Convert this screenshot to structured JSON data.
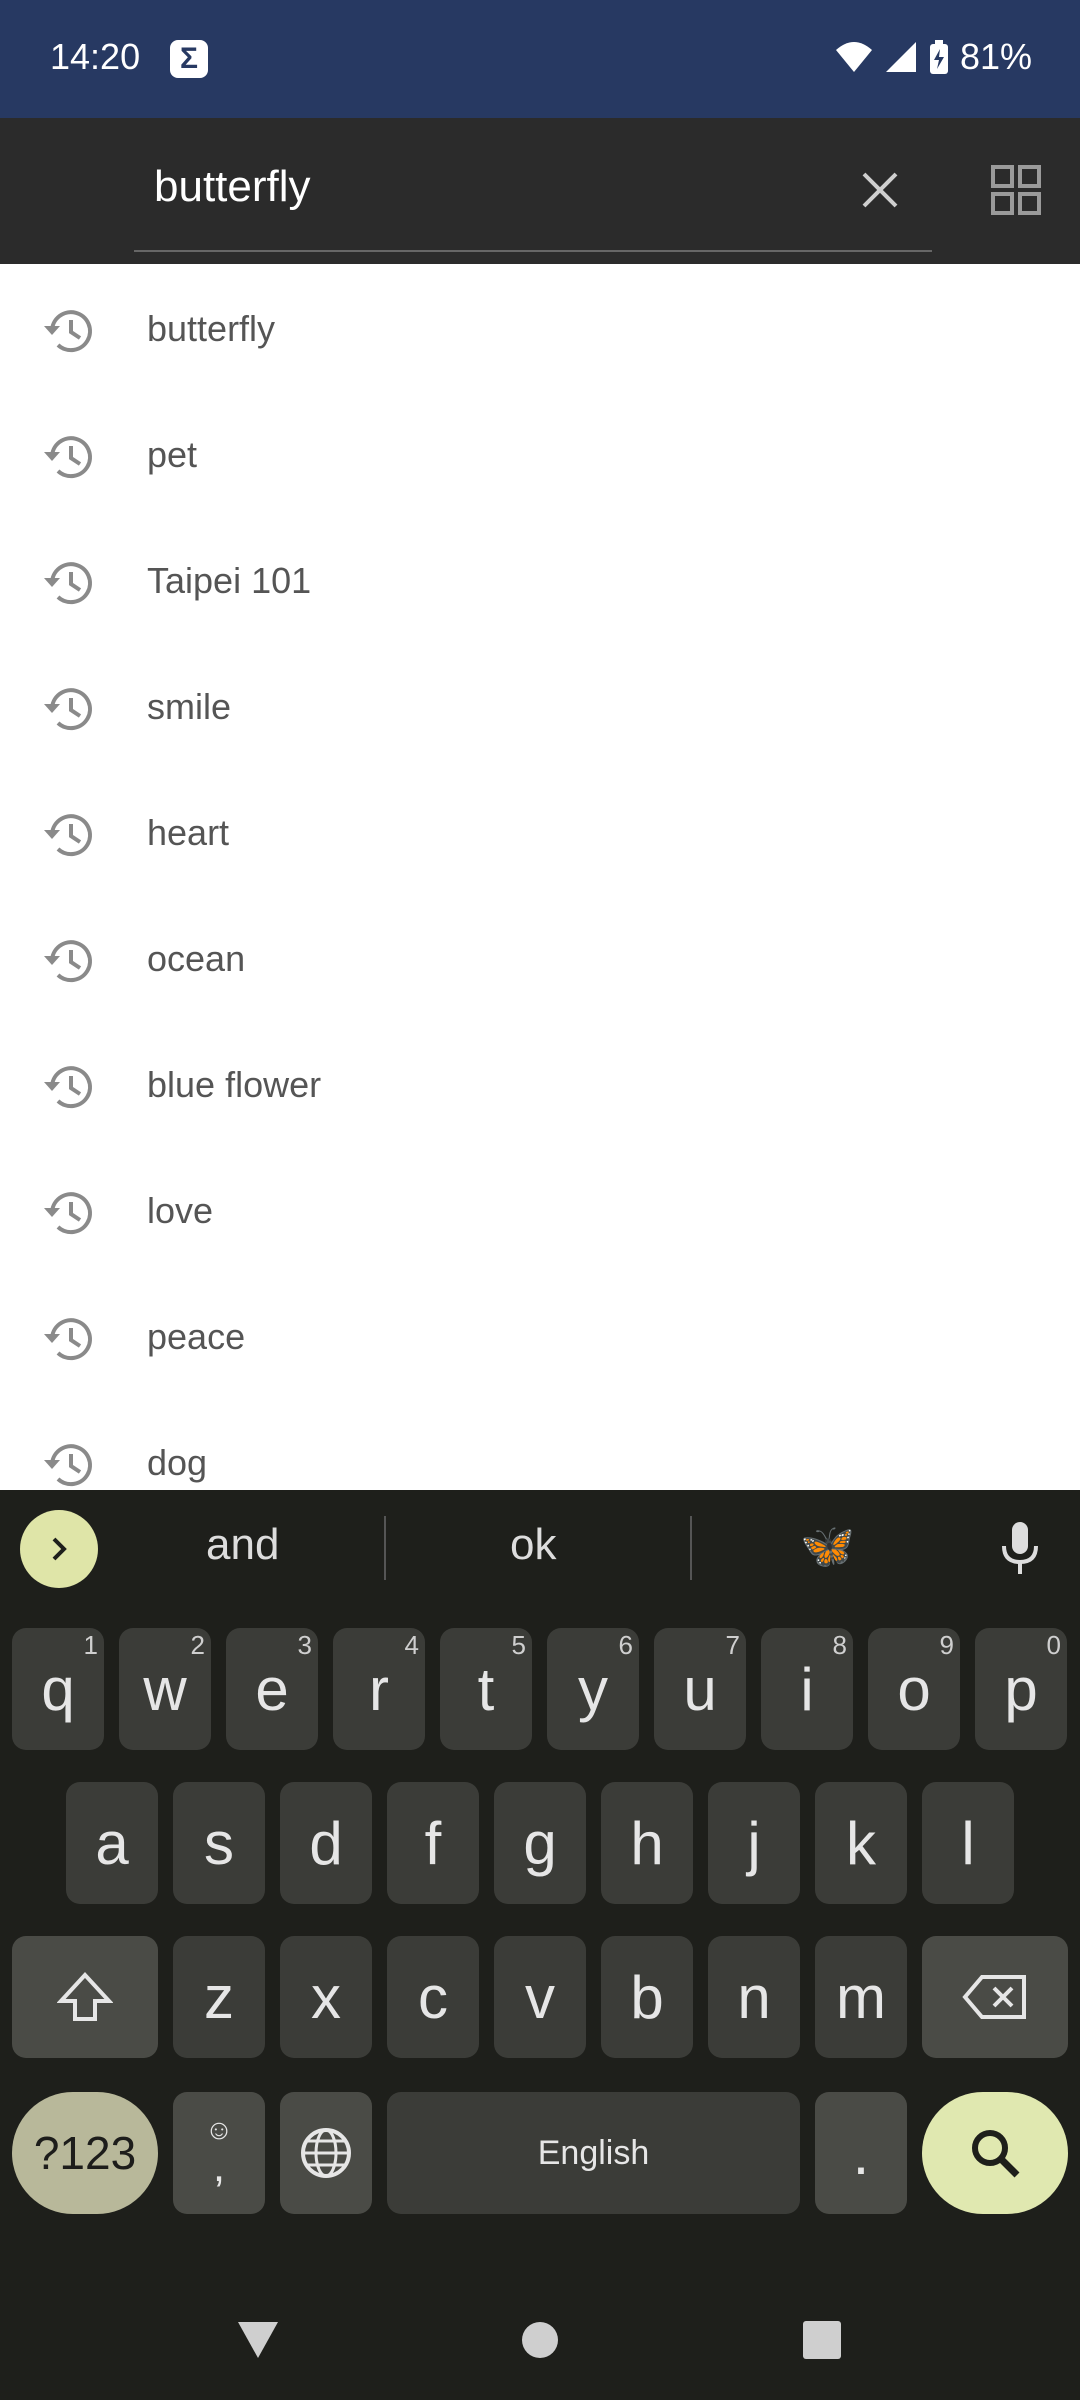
{
  "status_bar": {
    "time": "14:20",
    "app_icon": "sigma-icon",
    "battery_percent": "81%",
    "icons": [
      "wifi-icon",
      "signal-icon",
      "battery-charging-icon"
    ]
  },
  "search": {
    "query": "butterfly",
    "clear_icon": "close-icon",
    "grid_icon": "grid-view-icon"
  },
  "history": [
    "butterfly",
    "pet",
    "Taipei 101",
    "smile",
    "heart",
    "ocean",
    "blue flower",
    "love",
    "peace",
    "dog"
  ],
  "keyboard": {
    "suggestions": [
      "and",
      "ok",
      "🦋"
    ],
    "rows": [
      [
        [
          "q",
          "1"
        ],
        [
          "w",
          "2"
        ],
        [
          "e",
          "3"
        ],
        [
          "r",
          "4"
        ],
        [
          "t",
          "5"
        ],
        [
          "y",
          "6"
        ],
        [
          "u",
          "7"
        ],
        [
          "i",
          "8"
        ],
        [
          "o",
          "9"
        ],
        [
          "p",
          "0"
        ]
      ],
      [
        [
          "a",
          ""
        ],
        [
          "s",
          ""
        ],
        [
          "d",
          ""
        ],
        [
          "f",
          ""
        ],
        [
          "g",
          ""
        ],
        [
          "h",
          ""
        ],
        [
          "j",
          ""
        ],
        [
          "k",
          ""
        ],
        [
          "l",
          ""
        ]
      ],
      [
        [
          "z",
          ""
        ],
        [
          "x",
          ""
        ],
        [
          "c",
          ""
        ],
        [
          "v",
          ""
        ],
        [
          "b",
          ""
        ],
        [
          "n",
          ""
        ],
        [
          "m",
          ""
        ]
      ]
    ],
    "symbols_label": "?123",
    "comma_label": ",",
    "emoji_hint": "☺",
    "space_label": "English",
    "period_label": ".",
    "colors": {
      "background": "#1e1f1b",
      "key": "#3b3c38",
      "accent": "#e0e8b0"
    }
  },
  "colors": {
    "status_bar": "#273962",
    "toolbar": "#2b2b2b"
  }
}
